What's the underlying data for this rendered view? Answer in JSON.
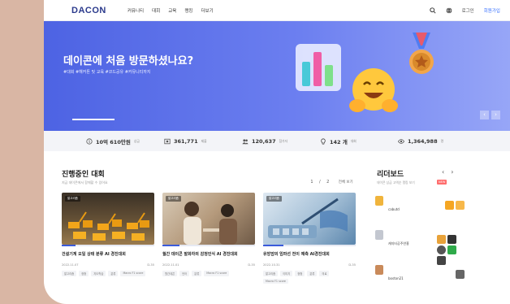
{
  "nav": {
    "logo": "DACON",
    "menu": [
      "커뮤니티",
      "대회",
      "교육",
      "랭킹",
      "더보기"
    ],
    "login": "로그인",
    "signup": "회원가입"
  },
  "hero": {
    "title": "데이콘에 처음 방문하셨나요?",
    "subtitle": "#대회 #해커톤 및 교육 #코드공유 #커뮤니티까지"
  },
  "stats": [
    {
      "icon": "coin-icon",
      "value": "10억 610만원",
      "unit": "상금"
    },
    {
      "icon": "trophy-board-icon",
      "value": "361,771",
      "unit": "제출"
    },
    {
      "icon": "users-icon",
      "value": "120,637",
      "unit": "참가자"
    },
    {
      "icon": "lightbulb-icon",
      "value": "142 개",
      "unit": "대회"
    },
    {
      "icon": "eye-icon",
      "value": "1,364,988",
      "unit": "명"
    }
  ],
  "competitions": {
    "title": "진행중인 대회",
    "subtitle": "지금 데이콘에서 함께할 수 있어요",
    "pager": {
      "prev": "1",
      "next": "2",
      "more": "전체 보기"
    },
    "cards": [
      {
        "tag": "알고리즘",
        "title": "건설기계 오일 상태 분류 AI 경진대회",
        "date": "2022.11.07",
        "dday": "D-35",
        "progress": 0.15,
        "chips": [
          "알고리즘",
          "정형",
          "지도학습",
          "분류",
          "Macro F1 score"
        ]
      },
      {
        "tag": "알고리즘",
        "title": "월간 데이콘 발화자의 감정인식 AI 경진대회",
        "date": "2022.11.01",
        "dday": "D-35",
        "progress": 0.18,
        "chips": [
          "월간데콘",
          "언어",
          "분류",
          "Macro F1 score"
        ]
      },
      {
        "tag": "알고리즘",
        "title": "유방암의 임파선 전이 예측 AI경진대회",
        "date": "2022.10.31",
        "dday": "D-35",
        "progress": 0.22,
        "chips": [
          "알고리즘",
          "이미지",
          "정형",
          "분류",
          "의료",
          "Macro F1 score"
        ]
      }
    ]
  },
  "leaderboard": {
    "title": "리더보드",
    "subtitle": "데이콘 상금 고액순 랭킹 보기",
    "badge": "NEW",
    "prev": "‹",
    "next": "›",
    "rows": [
      {
        "name": "cabutd"
      },
      {
        "name": "캐지터공주연홍"
      },
      {
        "name": "boston21"
      }
    ]
  },
  "colors": {
    "accent": "#3b5bdb",
    "hero_start": "#4d63e3",
    "hero_end": "#97a6f7"
  }
}
